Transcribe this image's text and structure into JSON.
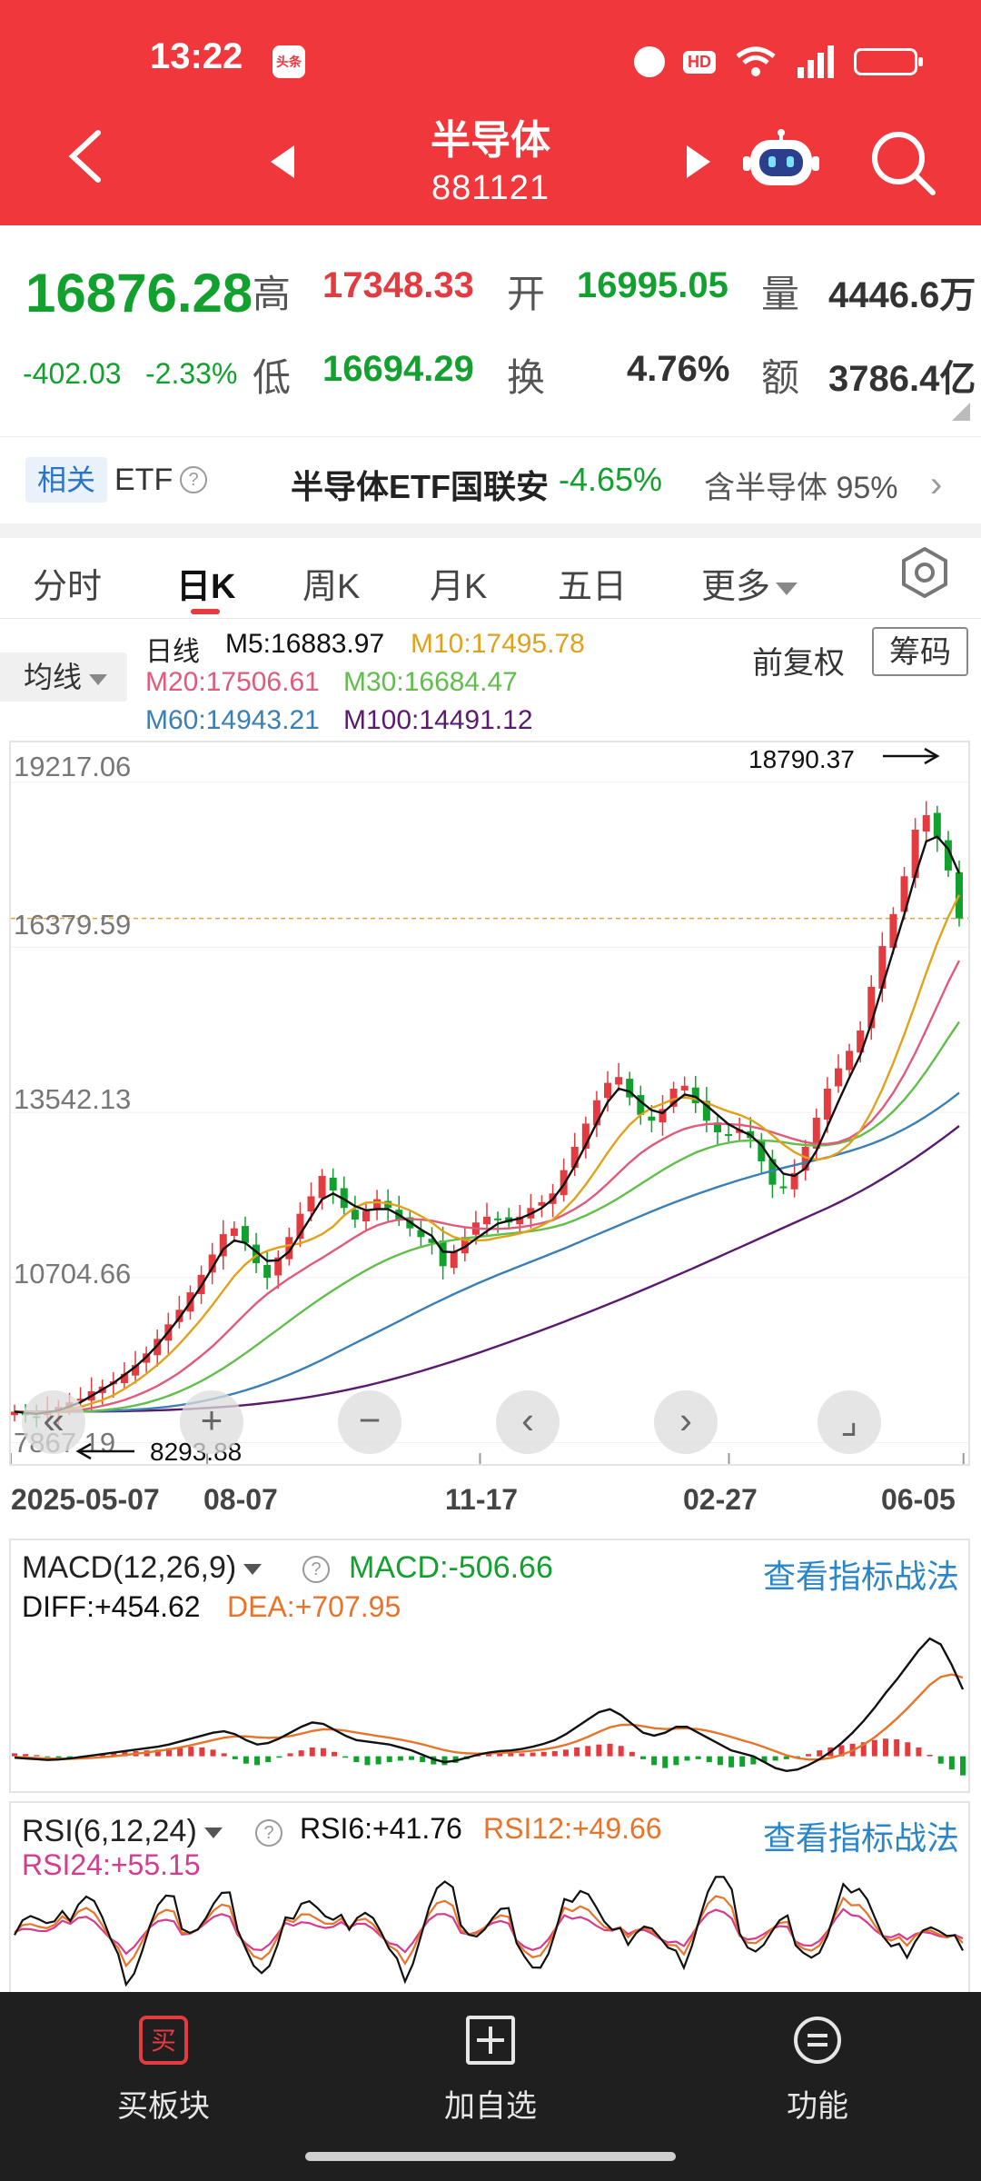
{
  "status_bar": {
    "time": "13:22",
    "toutiao": "头条",
    "hd": "HD"
  },
  "nav": {
    "title": "半导体",
    "code": "881121"
  },
  "quote": {
    "price": "16876.28",
    "change": "-402.03",
    "change_pct": "-2.33%",
    "high_label": "高",
    "high": "17348.33",
    "low_label": "低",
    "low": "16694.29",
    "open_label": "开",
    "open": "16995.05",
    "turnover_label": "换",
    "turnover": "4.76%",
    "volume_label": "量",
    "volume": "4446.6万",
    "amount_label": "额",
    "amount": "3786.4亿"
  },
  "etf_bar": {
    "tag": "相关",
    "label": "ETF",
    "name": "半导体ETF国联安",
    "change": "-4.65%",
    "holding": "含半导体 95%"
  },
  "tabs": [
    {
      "label": "分时"
    },
    {
      "label": "日K"
    },
    {
      "label": "周K"
    },
    {
      "label": "月K"
    },
    {
      "label": "五日"
    },
    {
      "label": "更多"
    }
  ],
  "ma_legend": {
    "button": "均线",
    "period": "日线",
    "m5": "M5:16883.97",
    "m10": "M10:17495.78",
    "m20": "M20:17506.61",
    "m30": "M30:16684.47",
    "m60": "M60:14943.21",
    "m100": "M100:14491.12",
    "adjust": "前复权",
    "chips": "筹码"
  },
  "colors": {
    "header_red": "#f0373c",
    "up_red": "#e33b3f",
    "down_green": "#12a12e",
    "m5": "#111111",
    "m10": "#e0a21a",
    "m20": "#e05a7a",
    "m30": "#5fbf4a",
    "m60": "#3a7fb5",
    "m100": "#5a1a6e",
    "link_blue": "#2a86c9"
  },
  "chart_data": {
    "type": "candlestick",
    "y_ticks": [
      "19217.06",
      "16379.59",
      "13542.13",
      "10704.66",
      "7867.19"
    ],
    "x_ticks": [
      "2025-05-07",
      "08-07",
      "11-17",
      "02-27",
      "06-05"
    ],
    "ylim": [
      7500,
      19900
    ],
    "high_annotation": "18790.37",
    "low_annotation": "8293.88",
    "close_series": [
      8400,
      8350,
      8300,
      8420,
      8480,
      8560,
      8620,
      8750,
      8830,
      8920,
      9050,
      9200,
      9400,
      9650,
      9900,
      10150,
      10450,
      10750,
      11100,
      11450,
      11550,
      11300,
      10950,
      10700,
      11050,
      11400,
      11800,
      12100,
      12450,
      12200,
      11900,
      11700,
      11850,
      12050,
      11900,
      11700,
      11550,
      11400,
      11300,
      10900,
      11150,
      11400,
      11650,
      11750,
      11700,
      11650,
      11750,
      11900,
      12000,
      12150,
      12550,
      12950,
      13350,
      13750,
      14050,
      14150,
      13800,
      13500,
      13400,
      13600,
      13950,
      14000,
      13700,
      13400,
      13200,
      13150,
      13250,
      13100,
      12700,
      12300,
      12250,
      12500,
      12950,
      13450,
      13950,
      14300,
      14600,
      14950,
      15700,
      16400,
      16950,
      17600,
      18400,
      18650,
      18250,
      17700,
      16876.28
    ],
    "m5": [
      8400,
      8380,
      8360,
      8390,
      8420,
      8490,
      8560,
      8670,
      8780,
      8890,
      9030,
      9170,
      9340,
      9540,
      9770,
      10010,
      10280,
      10560,
      10870,
      11190,
      11340,
      11300,
      11150,
      10990,
      11000,
      11150,
      11450,
      11750,
      12050,
      12150,
      12050,
      11930,
      11860,
      11880,
      11880,
      11780,
      11660,
      11530,
      11420,
      11150,
      11140,
      11230,
      11370,
      11500,
      11630,
      11680,
      11720,
      11800,
      11900,
      12050,
      12300,
      12620,
      12980,
      13360,
      13720,
      13950,
      13900,
      13730,
      13580,
      13530,
      13700,
      13850,
      13810,
      13660,
      13500,
      13340,
      13240,
      13150,
      12980,
      12700,
      12490,
      12450,
      12580,
      12880,
      13300,
      13730,
      14140,
      14530,
      15080,
      15700,
      16320,
      16940,
      17610,
      18200,
      18280,
      18070,
      17650
    ],
    "m10": [
      8400,
      8390,
      8380,
      8380,
      8400,
      8440,
      8480,
      8540,
      8600,
      8680,
      8790,
      8910,
      9050,
      9200,
      9370,
      9560,
      9770,
      9990,
      10230,
      10480,
      10730,
      10930,
      11080,
      11160,
      11220,
      11260,
      11290,
      11360,
      11450,
      11580,
      11770,
      11910,
      11990,
      12000,
      11980,
      11930,
      11860,
      11760,
      11650,
      11500,
      11400,
      11350,
      11340,
      11350,
      11390,
      11420,
      11460,
      11520,
      11600,
      11700,
      11870,
      12060,
      12300,
      12570,
      12850,
      13110,
      13330,
      13500,
      13620,
      13690,
      13770,
      13800,
      13770,
      13710,
      13630,
      13560,
      13500,
      13420,
      13300,
      13150,
      12990,
      12860,
      12770,
      12730,
      12760,
      12850,
      13000,
      13230,
      13550,
      13940,
      14390,
      14880,
      15400,
      15940,
      16450,
      16900,
      17280
    ],
    "m20": [
      8400,
      8395,
      8390,
      8390,
      8395,
      8410,
      8430,
      8460,
      8500,
      8545,
      8600,
      8670,
      8750,
      8840,
      8950,
      9070,
      9210,
      9360,
      9520,
      9700,
      9890,
      10080,
      10260,
      10420,
      10560,
      10690,
      10810,
      10930,
      11040,
      11160,
      11280,
      11400,
      11510,
      11600,
      11660,
      11700,
      11710,
      11700,
      11680,
      11640,
      11600,
      11570,
      11550,
      11540,
      11540,
      11550,
      11570,
      11600,
      11640,
      11690,
      11780,
      11880,
      12000,
      12150,
      12320,
      12500,
      12680,
      12840,
      12970,
      13080,
      13180,
      13260,
      13310,
      13340,
      13350,
      13340,
      13330,
      13300,
      13260,
      13200,
      13140,
      13080,
      13030,
      13000,
      13000,
      13030,
      13100,
      13220,
      13390,
      13610,
      13880,
      14200,
      14560,
      14960,
      15370,
      15780,
      16150
    ],
    "m30": [
      8400,
      8398,
      8395,
      8393,
      8392,
      8395,
      8400,
      8410,
      8425,
      8445,
      8470,
      8505,
      8550,
      8605,
      8670,
      8745,
      8830,
      8925,
      9030,
      9145,
      9270,
      9400,
      9535,
      9675,
      9815,
      9955,
      10095,
      10230,
      10360,
      10485,
      10605,
      10720,
      10830,
      10930,
      11020,
      11100,
      11170,
      11230,
      11280,
      11320,
      11350,
      11380,
      11400,
      11420,
      11440,
      11460,
      11480,
      11500,
      11530,
      11570,
      11620,
      11690,
      11770,
      11860,
      11960,
      12070,
      12190,
      12310,
      12430,
      12550,
      12660,
      12760,
      12850,
      12920,
      12980,
      13020,
      13050,
      13060,
      13060,
      13050,
      13030,
      13000,
      12980,
      12970,
      12980,
      13010,
      13060,
      13140,
      13250,
      13390,
      13560,
      13760,
      13990,
      14250,
      14530,
      14820,
      15100
    ],
    "m60": [
      8400,
      8400,
      8400,
      8400,
      8400,
      8402,
      8405,
      8408,
      8412,
      8418,
      8425,
      8435,
      8448,
      8465,
      8485,
      8510,
      8540,
      8575,
      8615,
      8660,
      8710,
      8765,
      8825,
      8890,
      8960,
      9035,
      9115,
      9200,
      9290,
      9385,
      9480,
      9575,
      9670,
      9765,
      9860,
      9955,
      10050,
      10145,
      10240,
      10330,
      10420,
      10505,
      10590,
      10670,
      10750,
      10825,
      10900,
      10975,
      11050,
      11125,
      11200,
      11280,
      11360,
      11440,
      11520,
      11600,
      11680,
      11760,
      11840,
      11915,
      11990,
      12060,
      12130,
      12195,
      12260,
      12320,
      12380,
      12435,
      12490,
      12540,
      12590,
      12635,
      12680,
      12725,
      12770,
      12820,
      12875,
      12935,
      13000,
      13075,
      13160,
      13255,
      13360,
      13475,
      13600,
      13735,
      13880
    ],
    "m100": [
      8400,
      8400,
      8400,
      8400,
      8400,
      8400,
      8401,
      8402,
      8403,
      8405,
      8408,
      8412,
      8417,
      8423,
      8430,
      8438,
      8447,
      8457,
      8468,
      8480,
      8495,
      8512,
      8531,
      8552,
      8575,
      8600,
      8628,
      8658,
      8690,
      8725,
      8762,
      8802,
      8845,
      8890,
      8938,
      8988,
      9040,
      9095,
      9152,
      9210,
      9270,
      9332,
      9395,
      9460,
      9526,
      9593,
      9661,
      9730,
      9800,
      9871,
      9943,
      10016,
      10090,
      10165,
      10241,
      10318,
      10396,
      10475,
      10555,
      10636,
      10718,
      10800,
      10883,
      10967,
      11051,
      11135,
      11220,
      11305,
      11390,
      11475,
      11560,
      11645,
      11730,
      11815,
      11900,
      11990,
      12085,
      12185,
      12290,
      12400,
      12515,
      12635,
      12760,
      12890,
      13025,
      13165,
      13310
    ]
  },
  "macd": {
    "selector": "MACD(12,26,9)",
    "macd": "MACD:-506.66",
    "diff": "DIFF:+454.62",
    "dea": "DEA:+707.95",
    "link": "查看指标战法",
    "hist": [
      20,
      15,
      8,
      -5,
      -10,
      -8,
      0,
      10,
      18,
      25,
      30,
      35,
      40,
      45,
      55,
      60,
      65,
      60,
      45,
      20,
      -20,
      -50,
      -60,
      -40,
      -10,
      20,
      40,
      60,
      55,
      30,
      -10,
      -40,
      -60,
      -55,
      -40,
      -30,
      -25,
      -40,
      -55,
      -60,
      -45,
      -20,
      5,
      15,
      20,
      22,
      20,
      25,
      30,
      35,
      45,
      60,
      70,
      80,
      85,
      70,
      30,
      -20,
      -60,
      -80,
      -60,
      -30,
      -20,
      -40,
      -60,
      -75,
      -70,
      -55,
      -40,
      -30,
      -20,
      -5,
      15,
      40,
      60,
      75,
      85,
      95,
      110,
      120,
      115,
      95,
      60,
      10,
      -50,
      -90,
      -130
    ],
    "diff_series": [
      -10,
      -15,
      -20,
      -25,
      -22,
      -15,
      -5,
      5,
      15,
      25,
      35,
      45,
      55,
      65,
      80,
      100,
      120,
      140,
      160,
      170,
      150,
      110,
      80,
      90,
      120,
      160,
      200,
      230,
      220,
      180,
      140,
      110,
      100,
      90,
      80,
      60,
      40,
      10,
      -20,
      -40,
      -30,
      -10,
      10,
      25,
      35,
      40,
      50,
      65,
      85,
      110,
      150,
      200,
      250,
      300,
      320,
      280,
      220,
      160,
      140,
      160,
      200,
      200,
      160,
      120,
      80,
      40,
      20,
      0,
      -40,
      -80,
      -100,
      -90,
      -60,
      -20,
      30,
      90,
      160,
      240,
      330,
      430,
      520,
      620,
      720,
      800,
      760,
      620,
      454.62
    ],
    "dea_series": [
      -5,
      -8,
      -12,
      -15,
      -17,
      -17,
      -15,
      -11,
      -6,
      0,
      8,
      17,
      26,
      36,
      47,
      60,
      75,
      92,
      110,
      126,
      135,
      135,
      129,
      125,
      128,
      137,
      153,
      172,
      183,
      182,
      174,
      161,
      149,
      137,
      126,
      113,
      98,
      81,
      61,
      41,
      27,
      20,
      18,
      20,
      23,
      27,
      31,
      38,
      47,
      60,
      78,
      102,
      132,
      166,
      197,
      213,
      215,
      204,
      191,
      185,
      188,
      190,
      184,
      171,
      153,
      131,
      109,
      87,
      62,
      34,
      7,
      -12,
      -22,
      -22,
      -11,
      9,
      39,
      79,
      129,
      189,
      255,
      328,
      406,
      485,
      540,
      556,
      535
    ]
  },
  "rsi": {
    "selector": "RSI(6,12,24)",
    "rsi6": "RSI6:+41.76",
    "rsi12": "RSI12:+49.66",
    "rsi24": "RSI24:+55.15",
    "link": "查看指标战法"
  },
  "chart_buttons": [
    {
      "name": "collapse-button",
      "glyph": "«"
    },
    {
      "name": "zoom-in-button",
      "glyph": "+"
    },
    {
      "name": "zoom-out-button",
      "glyph": "−"
    },
    {
      "name": "scroll-left-button",
      "glyph": "‹"
    },
    {
      "name": "scroll-right-button",
      "glyph": "›"
    },
    {
      "name": "fullscreen-button",
      "glyph": "⌟"
    }
  ],
  "bottom_bar": [
    {
      "label": "买板块",
      "icon": "buy-icon"
    },
    {
      "label": "加自选",
      "icon": "add-watchlist-icon"
    },
    {
      "label": "功能",
      "icon": "menu-icon"
    }
  ]
}
